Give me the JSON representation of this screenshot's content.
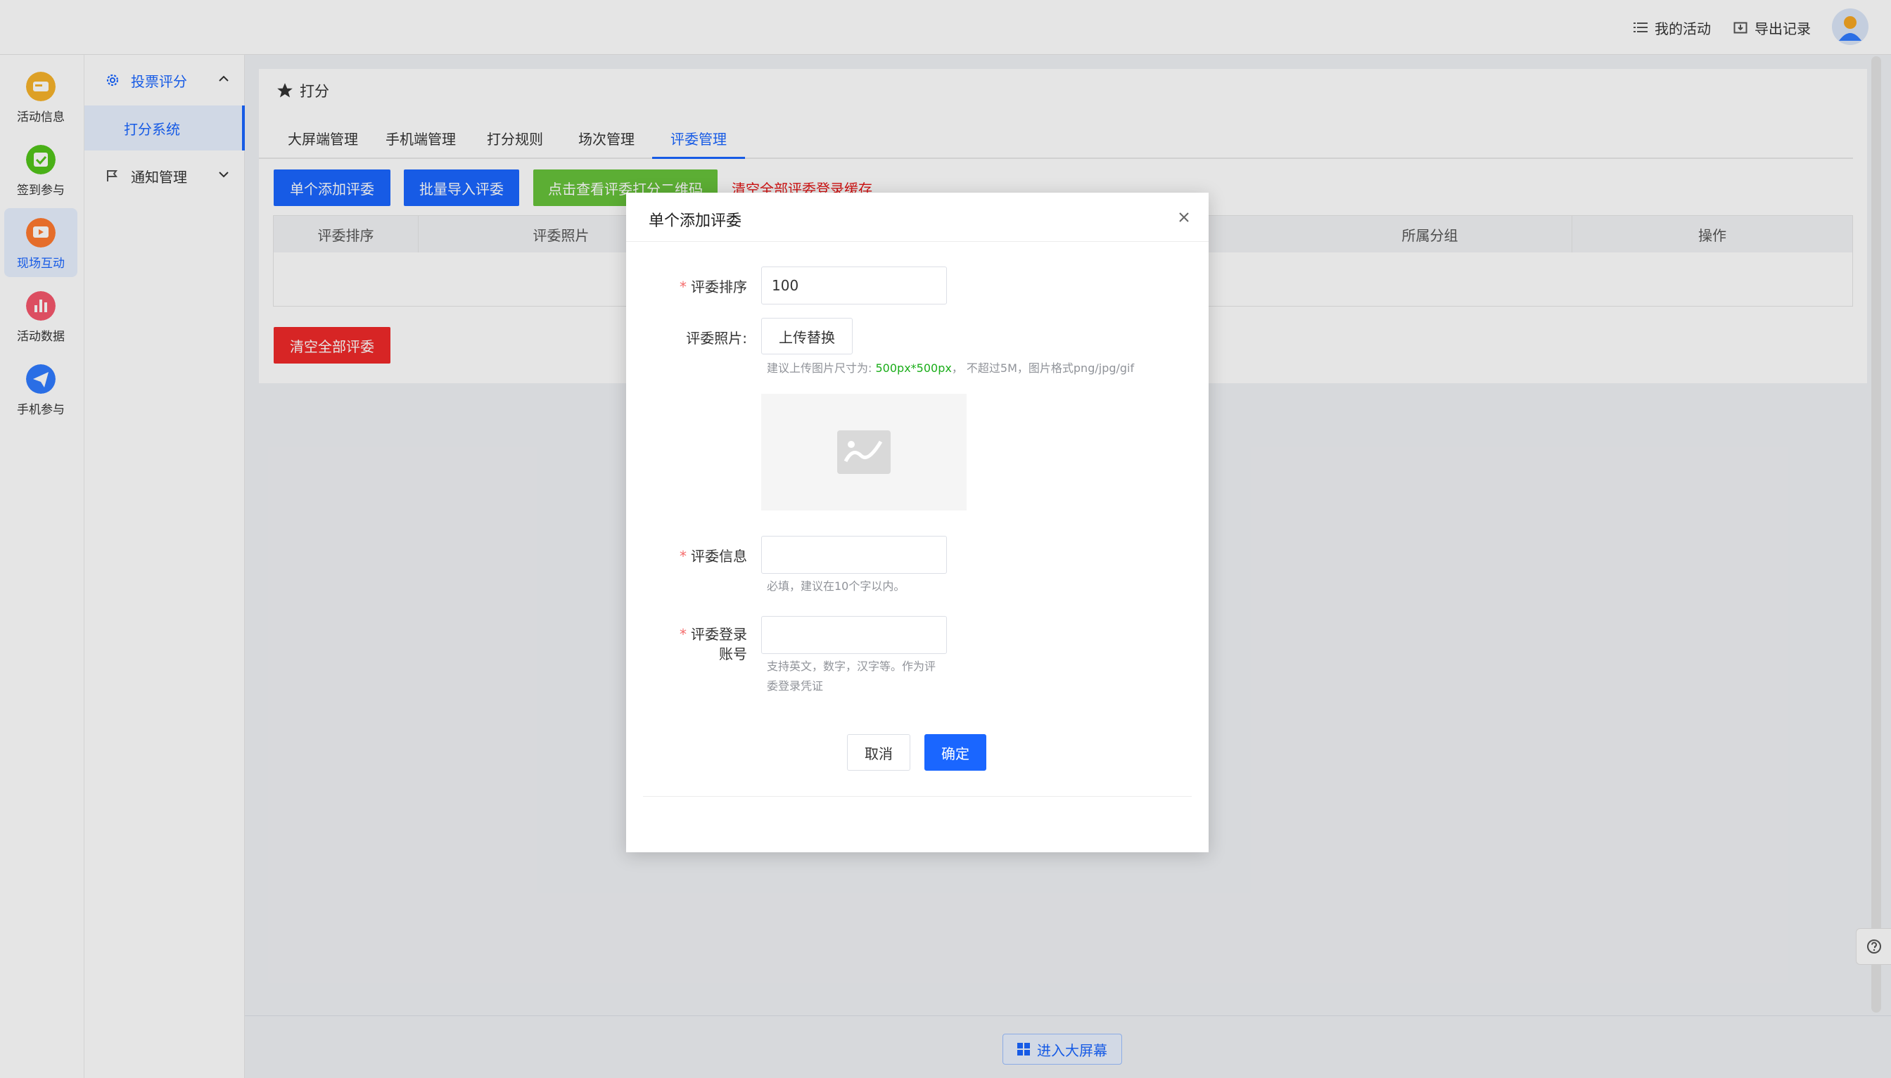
{
  "topbar": {
    "my_activity": "我的活动",
    "export_records": "导出记录"
  },
  "rail": {
    "items": [
      {
        "label": "活动信息",
        "color": "#f5a623"
      },
      {
        "label": "签到参与",
        "color": "#52c41a"
      },
      {
        "label": "现场互动",
        "color": "#ff7a2f"
      },
      {
        "label": "活动数据",
        "color": "#f5576c"
      },
      {
        "label": "手机参与",
        "color": "#2f7bff"
      }
    ]
  },
  "submenu": {
    "group1": "投票评分",
    "group1_item": "打分系统",
    "group2": "通知管理"
  },
  "content": {
    "breadcrumb": "打分",
    "tabs": [
      "大屏端管理",
      "手机端管理",
      "打分规则",
      "场次管理",
      "评委管理"
    ],
    "buttons": {
      "add_single": "单个添加评委",
      "batch_import": "批量导入评委",
      "view_qr": "点击查看评委打分二维码",
      "clear_cache": "清空全部评委登录缓存",
      "clear_all": "清空全部评委"
    },
    "table_headers": [
      "评委排序",
      "评委照片",
      "所属分组",
      "操作"
    ]
  },
  "bottom": {
    "enter_big_screen": "进入大屏幕"
  },
  "modal": {
    "title": "单个添加评委",
    "fields": {
      "order_label": "评委排序",
      "order_value": "100",
      "photo_label": "评委照片:",
      "upload_label": "上传替换",
      "photo_hint_prefix": "建议上传图片尺寸为:",
      "photo_hint_size": "500px*500px",
      "photo_hint_suffix": "， 不超过5M，图片格式png/jpg/gif",
      "info_label": "评委信息",
      "info_value": "",
      "info_hint": "必填，建议在10个字以内。",
      "account_label_line1": "评委登录",
      "account_label_line2": "账号",
      "account_value": "",
      "account_hint_line1": "支持英文，数字，汉字等。作为评",
      "account_hint_line2": "委登录凭证"
    },
    "cancel": "取消",
    "confirm": "确定"
  }
}
